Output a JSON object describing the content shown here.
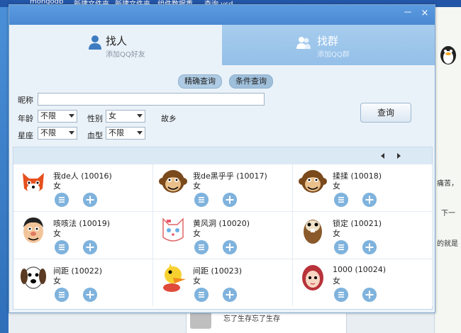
{
  "background": {
    "taskbar_items": [
      "mongodb",
      "新建文件夹",
      "新建文件夹",
      "组件数据重",
      "查询.vsd"
    ],
    "post_text": "忘了生存忘了生存",
    "right_snippets": [
      "痛苦，",
      "下一",
      "的就是"
    ]
  },
  "window": {
    "title_buttons": {
      "minimize": "－",
      "close": "×"
    },
    "tabs": [
      {
        "title": "找人",
        "subtitle": "添加QQ好友",
        "active": true
      },
      {
        "title": "找群",
        "subtitle": "添加QQ群",
        "active": false
      }
    ]
  },
  "query_modes": {
    "exact": "精确查询",
    "conditional": "条件查询",
    "selected": "conditional"
  },
  "form": {
    "nickname_label": "昵称",
    "nickname_value": "",
    "age_label": "年龄",
    "age_value": "不限",
    "gender_label": "性别",
    "gender_value": "女",
    "hometown_label": "故乡",
    "zodiac_label": "星座",
    "zodiac_value": "不限",
    "blood_label": "血型",
    "blood_value": "不限",
    "search_button": "查询"
  },
  "results": [
    {
      "name": "我de人 (10016)",
      "gender": "女",
      "avatar": "fox-avatar"
    },
    {
      "name": "我de黑乎乎 (10017)",
      "gender": "女",
      "avatar": "monkey-avatar"
    },
    {
      "name": "揉揉 (10018)",
      "gender": "女",
      "avatar": "monkey-avatar"
    },
    {
      "name": "咳咳法 (10019)",
      "gender": "女",
      "avatar": "man-avatar"
    },
    {
      "name": "黄风洞 (10020)",
      "gender": "女",
      "avatar": "cat-avatar"
    },
    {
      "name": "锁定 (10021)",
      "gender": "女",
      "avatar": "beaver-avatar"
    },
    {
      "name": "间距 (10022)",
      "gender": "女",
      "avatar": "dog-avatar"
    },
    {
      "name": "间距 (10023)",
      "gender": "女",
      "avatar": "duck-avatar"
    },
    {
      "name": "1000 (10024)",
      "gender": "女",
      "avatar": "girl-avatar"
    }
  ],
  "colors": {
    "title_bar": "#4b8ad3",
    "panel": "#eaf2f9",
    "action_button": "#7fb3dd"
  }
}
